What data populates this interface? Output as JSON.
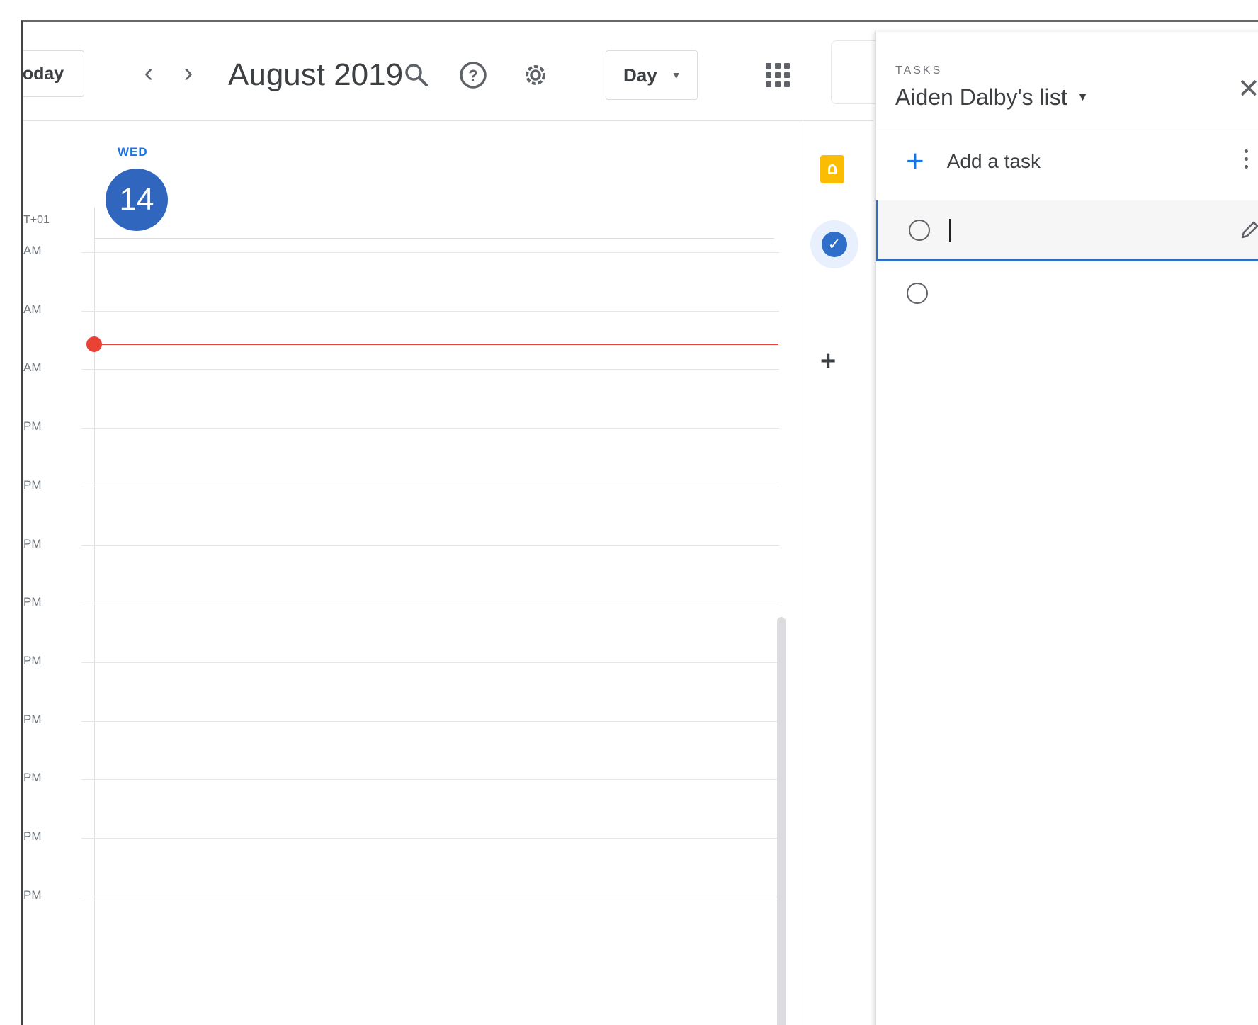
{
  "header": {
    "today_label": "oday",
    "prev_icon": "chevron-left-icon",
    "next_icon": "chevron-right-icon",
    "title": "August 2019",
    "search_icon": "search-icon",
    "help_icon": "help-icon",
    "settings_icon": "gear-icon",
    "view_label": "Day",
    "apps_icon": "apps-grid-icon"
  },
  "calendar": {
    "day_of_week": "WED",
    "day_number": "14",
    "timezone_label": "T+01",
    "hours": [
      "AM",
      "AM",
      "AM",
      "PM",
      "PM",
      "PM",
      "PM",
      "PM",
      "PM",
      "PM",
      "PM",
      "PM"
    ],
    "current_time_color": "#ea4335",
    "accent_color": "#3066be"
  },
  "side_rail": {
    "keep_icon": "keep-icon",
    "tasks_icon": "tasks-icon",
    "add_icon": "add-icon"
  },
  "tasks_panel": {
    "label": "TASKS",
    "list_name": "Aiden Dalby's list",
    "close_icon": "close-icon",
    "add_task_label": "Add a task",
    "more_icon": "more-vert-icon",
    "tasks": [
      {
        "title": "",
        "editing": true
      },
      {
        "title": "",
        "editing": false
      }
    ]
  }
}
